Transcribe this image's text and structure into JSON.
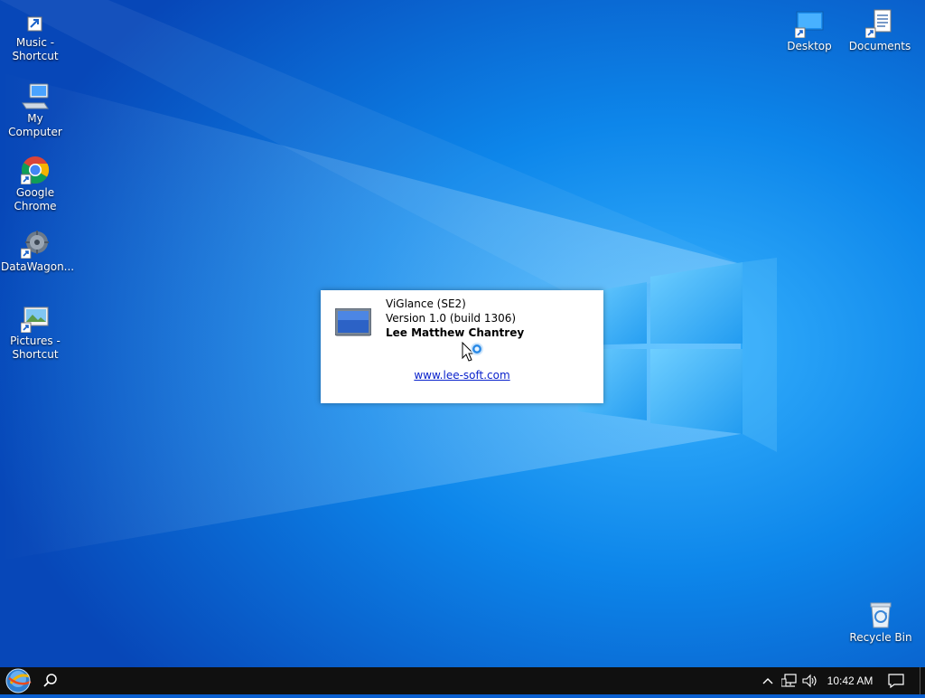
{
  "desktop": {
    "icons_left": [
      {
        "name": "music-shortcut",
        "label_line1": "Music -",
        "label_line2": "Shortcut",
        "icon": "music-folder-icon"
      },
      {
        "name": "my-computer",
        "label_line1": "My Computer",
        "label_line2": "",
        "icon": "computer-icon"
      },
      {
        "name": "google-chrome",
        "label_line1": "Google",
        "label_line2": "Chrome",
        "icon": "chrome-icon"
      },
      {
        "name": "datawagon",
        "label_line1": "DataWagon...",
        "label_line2": "",
        "icon": "datawagon-icon"
      },
      {
        "name": "pictures-shortcut",
        "label_line1": "Pictures -",
        "label_line2": "Shortcut",
        "icon": "pictures-icon"
      }
    ],
    "icons_right": [
      {
        "name": "desktop",
        "label": "Desktop",
        "icon": "desktop-folder-icon"
      },
      {
        "name": "documents",
        "label": "Documents",
        "icon": "documents-icon"
      },
      {
        "name": "recycle-bin",
        "label": "Recycle Bin",
        "icon": "recycle-bin-icon"
      }
    ]
  },
  "about_window": {
    "app_name": "ViGlance (SE2)",
    "version": "Version 1.0 (build 1306)",
    "author": "Lee Matthew Chantrey",
    "link": "www.lee-soft.com",
    "icon": "monitor-icon"
  },
  "taskbar": {
    "start_icon": "start-orb-icon",
    "search_icon": "search-icon",
    "tray_icons": [
      "chevron-up-icon",
      "network-icon",
      "volume-icon"
    ],
    "clock": "10:42 AM",
    "notification_icon": "action-center-icon"
  },
  "colors": {
    "wallpaper_dark": "#0747b8",
    "wallpaper_light": "#39b4ff",
    "taskbar": "#101010",
    "link": "#0a22cc"
  }
}
